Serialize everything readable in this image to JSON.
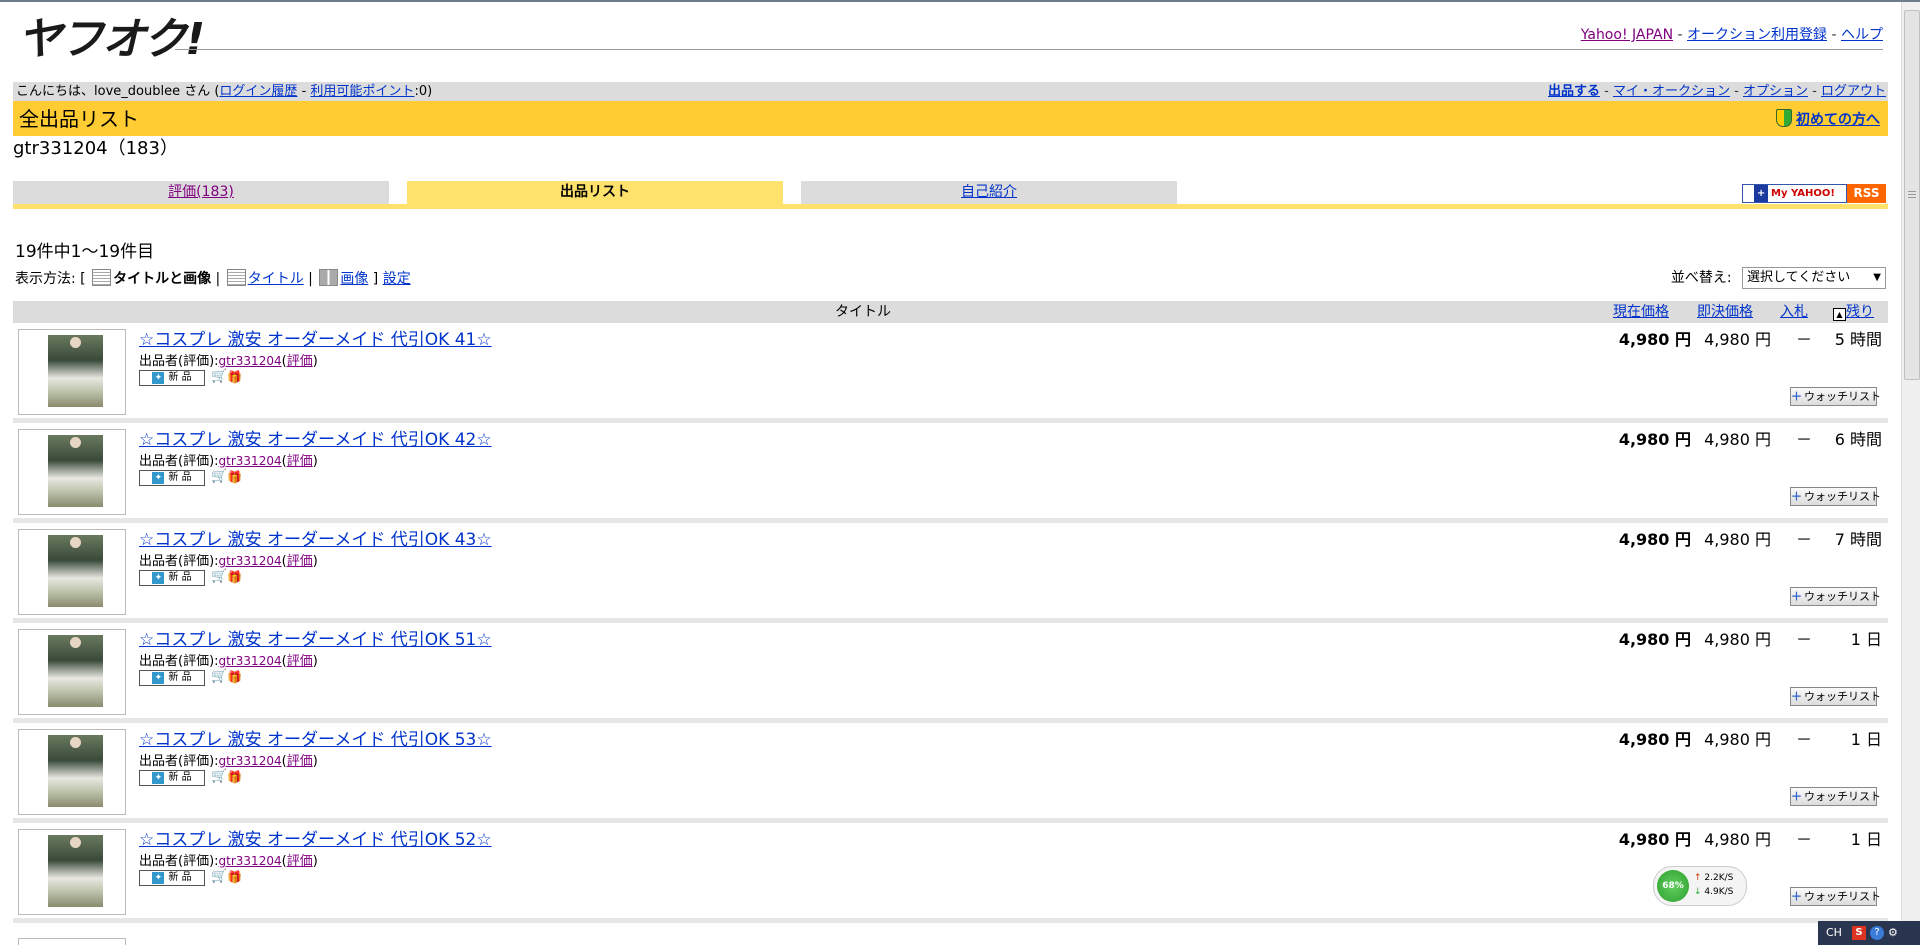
{
  "header": {
    "logo_text": "ヤフオク!",
    "top_links": [
      "Yahoo! JAPAN",
      "オークション利用登録",
      "ヘルプ"
    ]
  },
  "greeting": {
    "prefix": "こんにちは、",
    "username": "love_doublee",
    "suffix": " さん (",
    "login_history": "ログイン履歴",
    "points_label": "利用可能ポイント",
    "points_value": ":0)",
    "right_links": [
      "出品する",
      "マイ・オークション",
      "オプション",
      "ログアウト"
    ]
  },
  "title_bar": {
    "title": "全出品リスト",
    "beginner_link": "初めての方へ"
  },
  "seller_line": "gtr331204（183）",
  "tabs": {
    "rating": "評価(183)",
    "listings": "出品リスト",
    "profile": "自己紹介",
    "my_yahoo": "My YAHOO!",
    "rss": "RSS"
  },
  "results": {
    "count_text": "19件中1～19件目",
    "view_label": "表示方法: [",
    "view_title_image": "タイトルと画像",
    "view_title": "タイトル",
    "view_image": "画像",
    "view_close": "]",
    "settings": "設定",
    "sort_label": "並べ替え:",
    "sort_selected": "選択してください"
  },
  "columns": {
    "title": "タイトル",
    "current_price": "現在価格",
    "buy_now": "即決価格",
    "bids": "入札",
    "time_left": "残り"
  },
  "items": [
    {
      "title": "☆コスプレ 激安 オーダーメイド 代引OK 41☆",
      "seller_label": "出品者(評価):",
      "seller": "gtr331204",
      "rating_link": "評価",
      "badge": "新 品",
      "current_price": "4,980 円",
      "buy_now": "4,980 円",
      "bids": "－",
      "time_left": "5 時間",
      "watch": "ウォッチリスト"
    },
    {
      "title": "☆コスプレ 激安 オーダーメイド 代引OK 42☆",
      "seller_label": "出品者(評価):",
      "seller": "gtr331204",
      "rating_link": "評価",
      "badge": "新 品",
      "current_price": "4,980 円",
      "buy_now": "4,980 円",
      "bids": "－",
      "time_left": "6 時間",
      "watch": "ウォッチリスト"
    },
    {
      "title": "☆コスプレ 激安 オーダーメイド 代引OK 43☆",
      "seller_label": "出品者(評価):",
      "seller": "gtr331204",
      "rating_link": "評価",
      "badge": "新 品",
      "current_price": "4,980 円",
      "buy_now": "4,980 円",
      "bids": "－",
      "time_left": "7 時間",
      "watch": "ウォッチリスト"
    },
    {
      "title": "☆コスプレ 激安 オーダーメイド 代引OK 51☆",
      "seller_label": "出品者(評価):",
      "seller": "gtr331204",
      "rating_link": "評価",
      "badge": "新 品",
      "current_price": "4,980 円",
      "buy_now": "4,980 円",
      "bids": "－",
      "time_left": "1 日",
      "watch": "ウォッチリスト"
    },
    {
      "title": "☆コスプレ 激安 オーダーメイド 代引OK 53☆",
      "seller_label": "出品者(評価):",
      "seller": "gtr331204",
      "rating_link": "評価",
      "badge": "新 品",
      "current_price": "4,980 円",
      "buy_now": "4,980 円",
      "bids": "－",
      "time_left": "1 日",
      "watch": "ウォッチリスト"
    },
    {
      "title": "☆コスプレ 激安 オーダーメイド 代引OK 52☆",
      "seller_label": "出品者(評価):",
      "seller": "gtr331204",
      "rating_link": "評価",
      "badge": "新 品",
      "current_price": "4,980 円",
      "buy_now": "4,980 円",
      "bids": "－",
      "time_left": "1 日",
      "watch": "ウォッチリスト"
    }
  ],
  "net_widget": {
    "percent": "68%",
    "up": "2.2K/S",
    "down": "4.9K/S"
  },
  "tray": {
    "lang": "CH",
    "s_icon": "S",
    "help_icon": "?"
  },
  "colors": {
    "title_bar": "#ffcc33",
    "tab_active": "#ffe26b",
    "link": "#0033cc",
    "visited": "#800080"
  }
}
